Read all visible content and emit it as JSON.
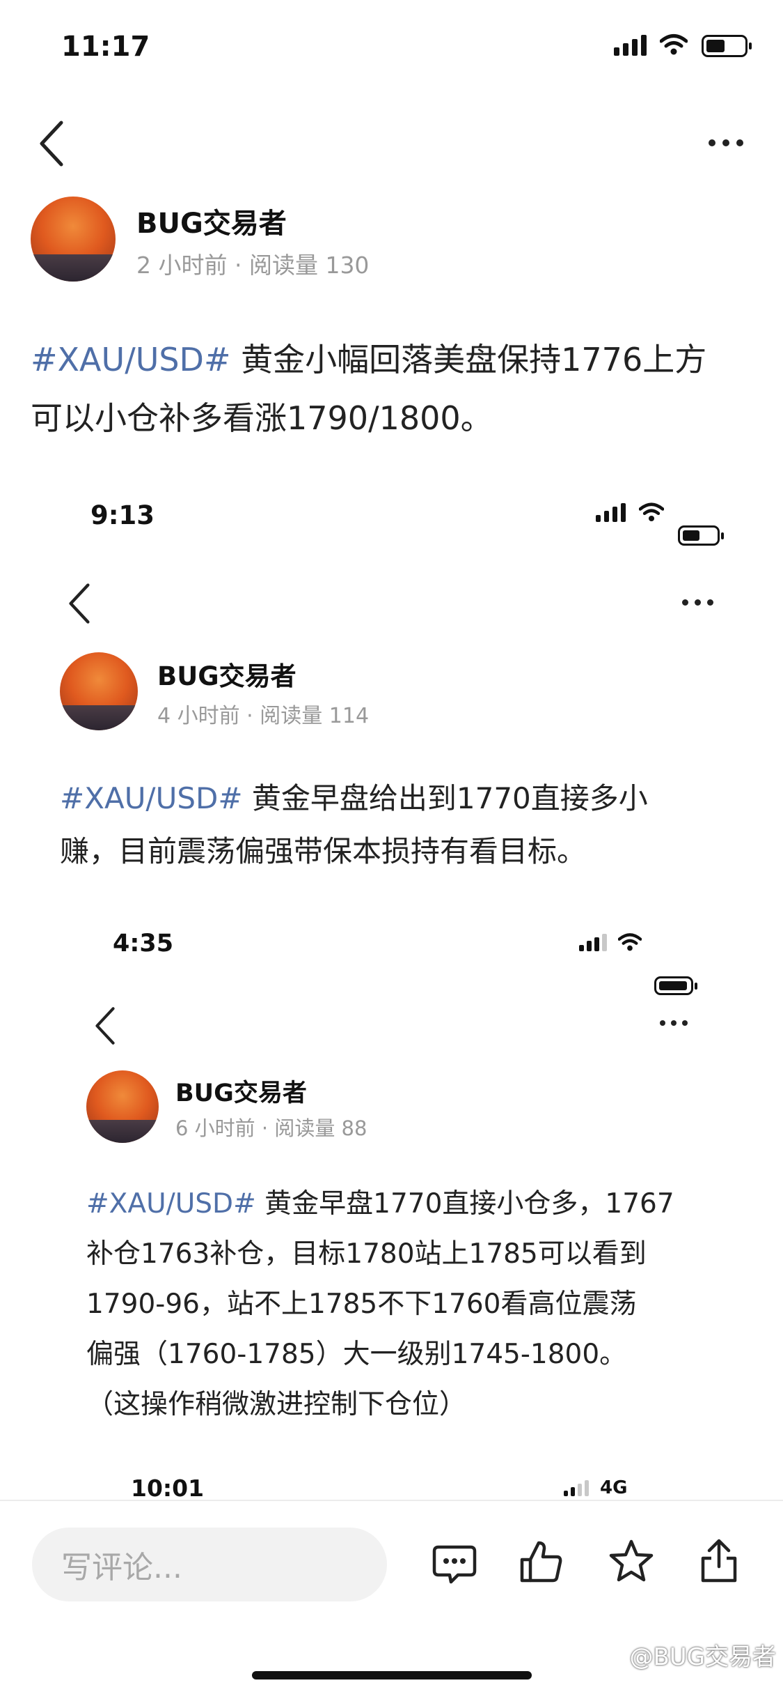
{
  "screen1": {
    "status_time": "11:17",
    "author": "BUG交易者",
    "meta": "2 小时前 · 阅读量 130",
    "post_tag": "#XAU/USD#",
    "post_line1": " 黄金小幅回落美盘保持1776上方",
    "post_line2": "可以小仓补多看涨1790/1800。"
  },
  "screen2": {
    "status_time": "9:13",
    "author": "BUG交易者",
    "meta": "4 小时前 · 阅读量 114",
    "post_tag": "#XAU/USD#",
    "post_line1": " 黄金早盘给出到1770直接多小",
    "post_line2": "赚，目前震荡偏强带保本损持有看目标。"
  },
  "screen3": {
    "status_time": "4:35",
    "author": "BUG交易者",
    "meta": "6 小时前 · 阅读量 88",
    "post_tag": "#XAU/USD#",
    "post_line1": " 黄金早盘1770直接小仓多，1767",
    "post_line2": "补仓1763补仓，目标1780站上1785可以看到",
    "post_line3": "1790-96，站不上1785不下1760看高位震荡",
    "post_line4": "偏强（1760-1785）大一级别1745-1800。",
    "post_line5": "（这操作稍微激进控制下仓位）"
  },
  "screen4": {
    "status_time": "10:01",
    "network": "4G"
  },
  "bottom_bar": {
    "comment_placeholder": "写评论...",
    "icons": [
      "comment-icon",
      "like-icon",
      "star-icon",
      "share-icon"
    ]
  },
  "watermark": "@BUG交易者",
  "colors": {
    "tag": "#4f6fa8",
    "meta": "#999999",
    "text": "#222222"
  }
}
